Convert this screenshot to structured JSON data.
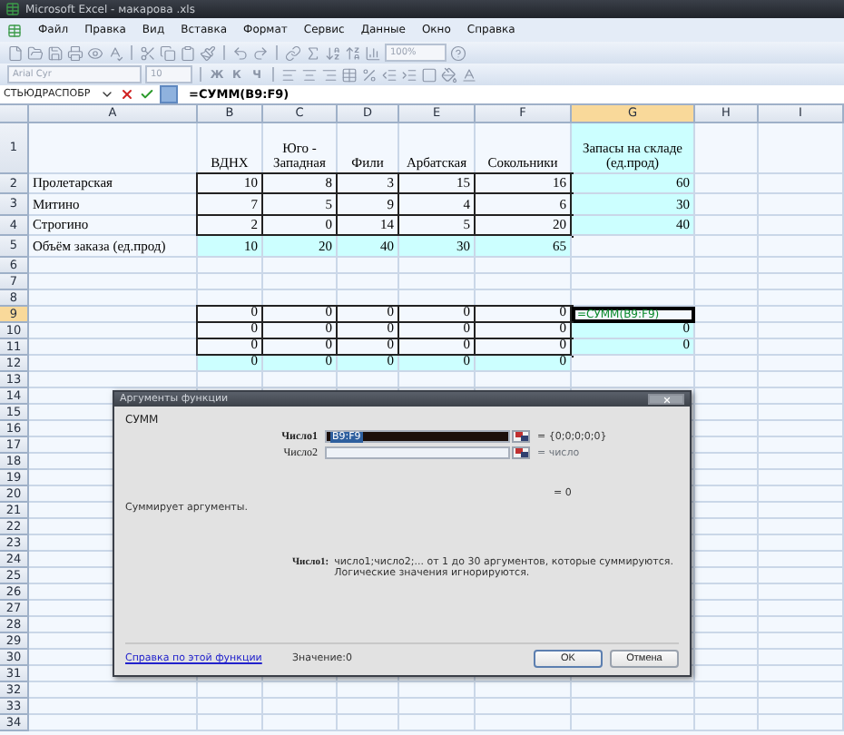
{
  "window": {
    "title": "Microsoft Excel - макарова .xls"
  },
  "menu": [
    "Файл",
    "Правка",
    "Вид",
    "Вставка",
    "Формат",
    "Сервис",
    "Данные",
    "Окно",
    "Справка"
  ],
  "toolbar": {
    "zoom": "100%"
  },
  "format_toolbar": {
    "font": "Arial Cyr",
    "size": "10",
    "style_buttons": [
      "Ж",
      "К",
      "Ч"
    ]
  },
  "formula_bar": {
    "name_box": "СТЬЮДРАСПОБР",
    "formula": "=СУММ(B9:F9)"
  },
  "columns": [
    {
      "label": "A",
      "selected": false
    },
    {
      "label": "B",
      "selected": false
    },
    {
      "label": "C",
      "selected": false
    },
    {
      "label": "D",
      "selected": false
    },
    {
      "label": "E",
      "selected": false
    },
    {
      "label": "F",
      "selected": false
    },
    {
      "label": "G",
      "selected": true
    },
    {
      "label": "H",
      "selected": false
    },
    {
      "label": "I",
      "selected": false
    }
  ],
  "rows": [
    {
      "number": "1",
      "selected": false,
      "kind": "header",
      "cells": [
        null,
        {
          "text": "ВДНХ"
        },
        {
          "text": "Юго - Западная"
        },
        {
          "text": "Фили"
        },
        {
          "text": "Арбатская"
        },
        {
          "text": "Сокольники"
        },
        {
          "text": "Запасы на складе (ед.прод)",
          "fill": true
        }
      ]
    },
    {
      "number": "2",
      "selected": false,
      "kind": "data",
      "cells": [
        {
          "text": "Пролетарская"
        },
        {
          "text": "10",
          "boxed": true
        },
        {
          "text": "8",
          "boxed": true
        },
        {
          "text": "3",
          "boxed": true
        },
        {
          "text": "15",
          "boxed": true
        },
        {
          "text": "16",
          "boxed": true
        },
        {
          "text": "60",
          "fill": true
        }
      ]
    },
    {
      "number": "3",
      "selected": false,
      "kind": "data",
      "cells": [
        {
          "text": "Митино"
        },
        {
          "text": "7",
          "boxed": true
        },
        {
          "text": "5",
          "boxed": true
        },
        {
          "text": "9",
          "boxed": true
        },
        {
          "text": "4",
          "boxed": true
        },
        {
          "text": "6",
          "boxed": true
        },
        {
          "text": "30",
          "fill": true
        }
      ]
    },
    {
      "number": "4",
      "selected": false,
      "kind": "data",
      "cells": [
        {
          "text": "Строгино"
        },
        {
          "text": "2",
          "boxed": true
        },
        {
          "text": "0",
          "boxed": true
        },
        {
          "text": "14",
          "boxed": true
        },
        {
          "text": "5",
          "boxed": true
        },
        {
          "text": "20",
          "boxed": true
        },
        {
          "text": "40",
          "fill": true
        }
      ]
    },
    {
      "number": "5",
      "selected": false,
      "kind": "data",
      "cells": [
        {
          "text": "Объём заказа (ед.прод)"
        },
        {
          "text": "10",
          "fill": true
        },
        {
          "text": "20",
          "fill": true
        },
        {
          "text": "40",
          "fill": true
        },
        {
          "text": "30",
          "fill": true
        },
        {
          "text": "65",
          "fill": true
        }
      ]
    },
    {
      "number": "6",
      "selected": false,
      "kind": "data",
      "cells": []
    },
    {
      "number": "7",
      "selected": false,
      "kind": "data",
      "cells": []
    },
    {
      "number": "8",
      "selected": false,
      "kind": "data",
      "cells": []
    },
    {
      "number": "9",
      "selected": true,
      "kind": "data",
      "cells": [
        null,
        {
          "text": "0",
          "boxed": true
        },
        {
          "text": "0",
          "boxed": true
        },
        {
          "text": "0",
          "boxed": true
        },
        {
          "text": "0",
          "boxed": true
        },
        {
          "text": "0",
          "boxed": true
        },
        {
          "text": "=СУММ(B9:F9)",
          "active": true
        }
      ]
    },
    {
      "number": "10",
      "selected": false,
      "kind": "data",
      "cells": [
        null,
        {
          "text": "0",
          "boxed": true
        },
        {
          "text": "0",
          "boxed": true
        },
        {
          "text": "0",
          "boxed": true
        },
        {
          "text": "0",
          "boxed": true
        },
        {
          "text": "0",
          "boxed": true
        },
        {
          "text": "0",
          "fill": true
        }
      ]
    },
    {
      "number": "11",
      "selected": false,
      "kind": "data",
      "cells": [
        null,
        {
          "text": "0",
          "boxed": true
        },
        {
          "text": "0",
          "boxed": true
        },
        {
          "text": "0",
          "boxed": true
        },
        {
          "text": "0",
          "boxed": true
        },
        {
          "text": "0",
          "boxed": true
        },
        {
          "text": "0",
          "fill": true
        }
      ]
    },
    {
      "number": "12",
      "selected": false,
      "kind": "data",
      "cells": [
        null,
        {
          "text": "0",
          "fill": true
        },
        {
          "text": "0",
          "fill": true
        },
        {
          "text": "0",
          "fill": true
        },
        {
          "text": "0",
          "fill": true
        },
        {
          "text": "0",
          "fill": true
        }
      ]
    },
    {
      "number": "13",
      "selected": false,
      "kind": "data",
      "cells": []
    },
    {
      "number": "14",
      "selected": false,
      "kind": "data",
      "cells": []
    },
    {
      "number": "15",
      "selected": false,
      "kind": "data",
      "cells": []
    },
    {
      "number": "16",
      "selected": false,
      "kind": "data",
      "cells": []
    },
    {
      "number": "17",
      "selected": false,
      "kind": "data",
      "cells": []
    },
    {
      "number": "18",
      "selected": false,
      "kind": "data",
      "cells": []
    },
    {
      "number": "19",
      "selected": false,
      "kind": "data",
      "cells": []
    },
    {
      "number": "20",
      "selected": false,
      "kind": "data",
      "cells": []
    },
    {
      "number": "21",
      "selected": false,
      "kind": "data",
      "cells": []
    },
    {
      "number": "22",
      "selected": false,
      "kind": "data",
      "cells": []
    },
    {
      "number": "23",
      "selected": false,
      "kind": "data",
      "cells": []
    },
    {
      "number": "24",
      "selected": false,
      "kind": "data",
      "cells": []
    },
    {
      "number": "25",
      "selected": false,
      "kind": "data",
      "cells": []
    },
    {
      "number": "26",
      "selected": false,
      "kind": "data",
      "cells": []
    },
    {
      "number": "27",
      "selected": false,
      "kind": "data",
      "cells": []
    },
    {
      "number": "28",
      "selected": false,
      "kind": "data",
      "cells": []
    },
    {
      "number": "29",
      "selected": false,
      "kind": "data",
      "cells": []
    },
    {
      "number": "30",
      "selected": false,
      "kind": "data",
      "cells": []
    },
    {
      "number": "31",
      "selected": false,
      "kind": "data",
      "cells": []
    },
    {
      "number": "32",
      "selected": false,
      "kind": "data",
      "cells": []
    },
    {
      "number": "33",
      "selected": false,
      "kind": "data",
      "cells": []
    },
    {
      "number": "34",
      "selected": false,
      "kind": "data",
      "cells": []
    }
  ],
  "dialog": {
    "title": "Аргументы функции",
    "function": "СУММ",
    "arguments": [
      {
        "label": "Число1",
        "value": "B9:F9",
        "result": "= {0;0;0;0;0}",
        "active": true
      },
      {
        "label": "Число2",
        "result": "= число",
        "active": false
      }
    ],
    "total": "= 0",
    "description": "Суммирует аргументы.",
    "argument_help": {
      "label": "Число1:",
      "text": "число1;число2;... от 1 до 30 аргументов, которые суммируются.",
      "note": "Логические значения игнорируются."
    },
    "help_link": "Справка по этой функции",
    "value": "Значение:0",
    "buttons": [
      {
        "label": "OK",
        "default": true
      },
      {
        "label": "Отмена",
        "default": false
      }
    ]
  }
}
